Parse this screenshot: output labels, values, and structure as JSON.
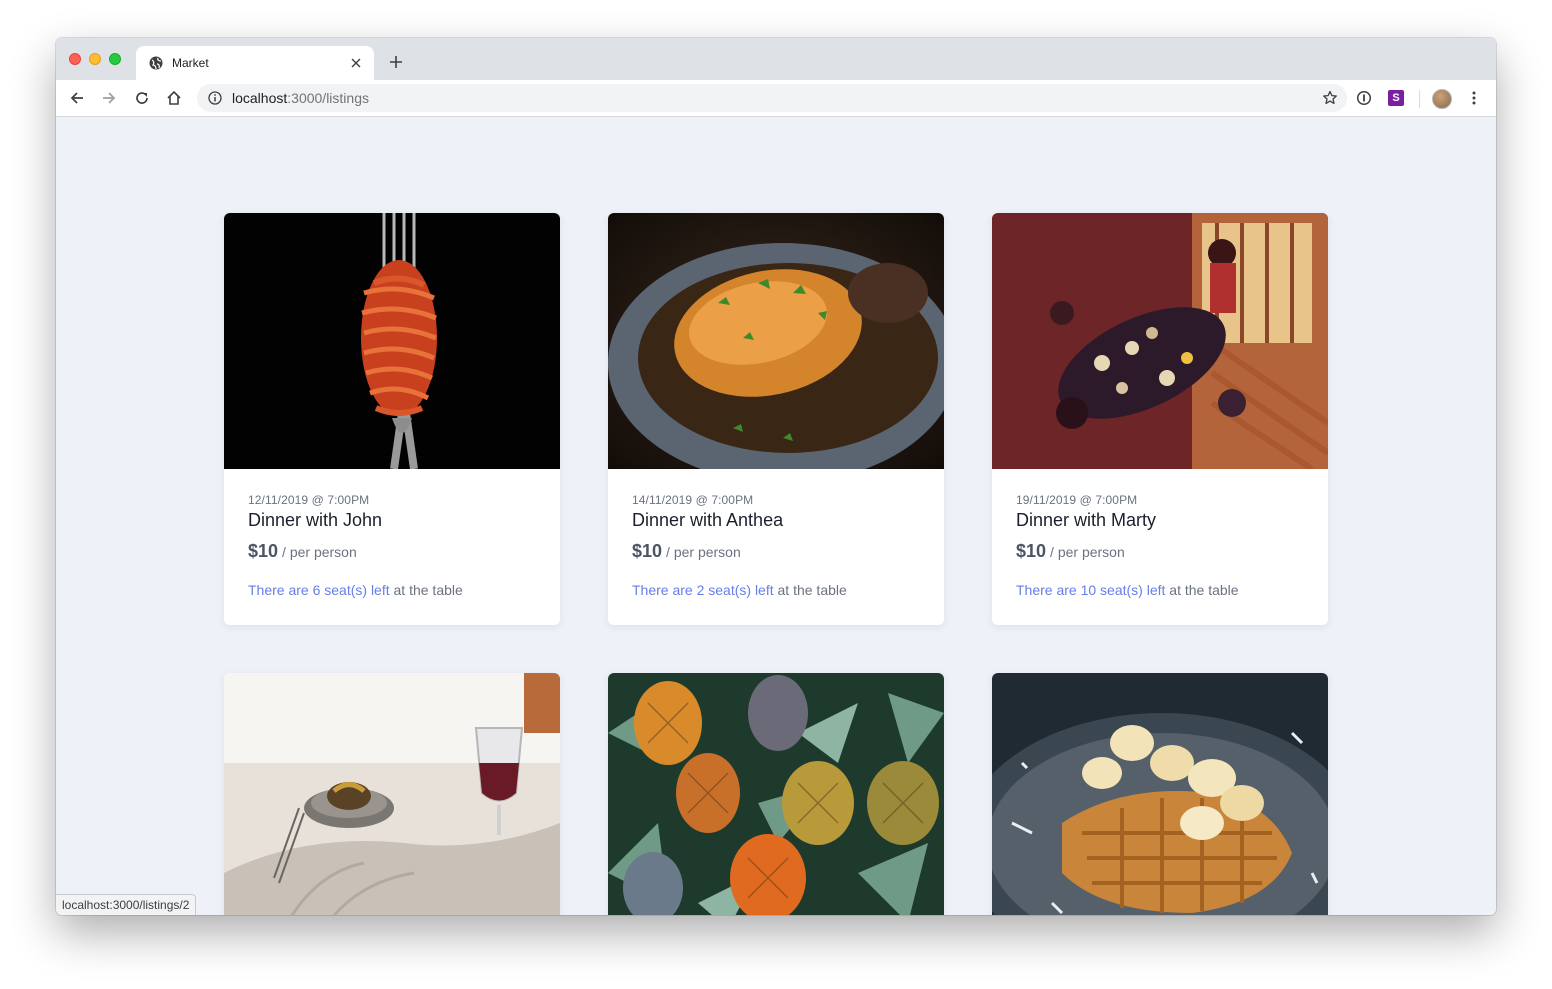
{
  "browser": {
    "tab_title": "Market",
    "url_host": "localhost",
    "url_path": ":3000/listings",
    "extension_label": "S",
    "status_url": "localhost:3000/listings/2"
  },
  "listings": [
    {
      "date": "12/11/2019 @ 7:00PM",
      "title": "Dinner with John",
      "price": "$10",
      "unit": "/ per person",
      "seats_prefix": "There are 6 seat(s) left",
      "seats_suffix": " at the table",
      "image": "spaghetti-on-fork"
    },
    {
      "date": "14/11/2019 @ 7:00PM",
      "title": "Dinner with Anthea",
      "price": "$10",
      "unit": "/ per person",
      "seats_prefix": "There are 2 seat(s) left",
      "seats_suffix": " at the table",
      "image": "roast-chicken-plate"
    },
    {
      "date": "19/11/2019 @ 7:00PM",
      "title": "Dinner with Marty",
      "price": "$10",
      "unit": "/ per person",
      "seats_prefix": "There are 10 seat(s) left",
      "seats_suffix": " at the table",
      "image": "restaurant-dining-table"
    },
    {
      "image": "plated-meal-with-wine"
    },
    {
      "image": "pineapples"
    },
    {
      "image": "waffles-with-bananas"
    }
  ],
  "colors": {
    "page_background": "#eef1f8",
    "accent": "#667eea",
    "title_text": "#1a202c",
    "muted_text": "#6b7280"
  }
}
